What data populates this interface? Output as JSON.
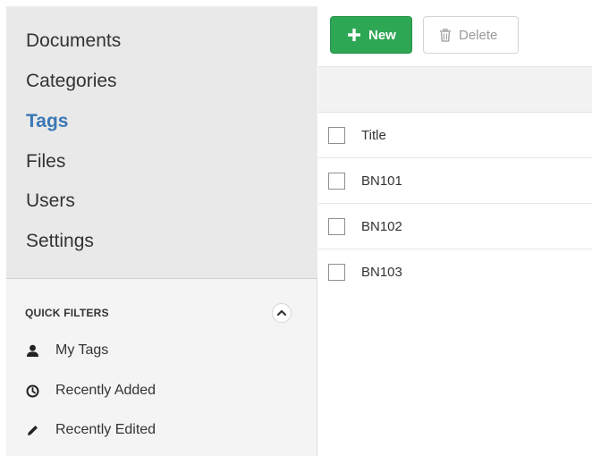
{
  "sidebar": {
    "nav": [
      {
        "label": "Documents",
        "active": false
      },
      {
        "label": "Categories",
        "active": false
      },
      {
        "label": "Tags",
        "active": true
      },
      {
        "label": "Files",
        "active": false
      },
      {
        "label": "Users",
        "active": false
      },
      {
        "label": "Settings",
        "active": false
      }
    ],
    "quick_filters": {
      "title": "QUICK FILTERS",
      "collapse_icon": "chevron-up-icon",
      "items": [
        {
          "label": "My Tags",
          "icon": "user-icon"
        },
        {
          "label": "Recently Added",
          "icon": "clock-icon"
        },
        {
          "label": "Recently Edited",
          "icon": "pencil-icon"
        }
      ]
    }
  },
  "toolbar": {
    "new_label": "New",
    "delete_label": "Delete",
    "new_color": "#2ea755"
  },
  "table": {
    "header": "Title",
    "rows": [
      "BN101",
      "BN102",
      "BN103"
    ]
  },
  "colors": {
    "active_nav": "#3a78b5"
  }
}
